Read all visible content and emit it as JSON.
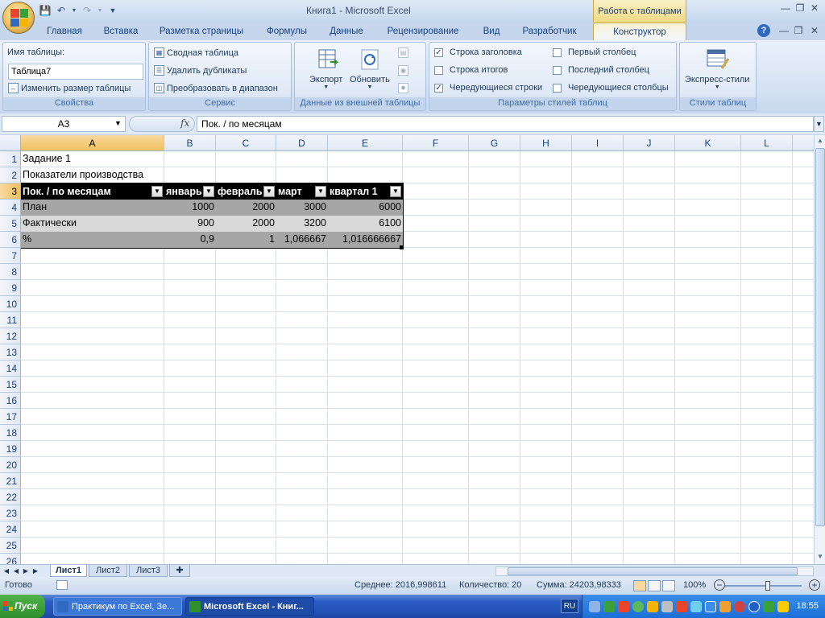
{
  "app": {
    "title": "Книга1 - Microsoft Excel",
    "context_tab_header": "Работа с таблицами"
  },
  "ribbon_tabs": [
    "Главная",
    "Вставка",
    "Разметка страницы",
    "Формулы",
    "Данные",
    "Рецензирование",
    "Вид",
    "Разработчик",
    "Конструктор"
  ],
  "ribbon": {
    "properties": {
      "title": "Свойства",
      "name_label": "Имя таблицы:",
      "name_value": "Таблица7",
      "resize_label": "Изменить размер таблицы"
    },
    "tools": {
      "title": "Сервис",
      "pivot_label": "Сводная таблица",
      "remove_dup_label": "Удалить дубликаты",
      "convert_label": "Преобразовать в диапазон"
    },
    "external": {
      "title": "Данные из внешней таблицы",
      "export_label": "Экспорт",
      "refresh_label": "Обновить"
    },
    "style_options": {
      "title": "Параметры стилей таблиц",
      "header_row": {
        "label": "Строка заголовка",
        "checked": true
      },
      "total_row": {
        "label": "Строка итогов",
        "checked": false
      },
      "banded_rows": {
        "label": "Чередующиеся строки",
        "checked": true
      },
      "first_column": {
        "label": "Первый столбец",
        "checked": false
      },
      "last_column": {
        "label": "Последний столбец",
        "checked": false
      },
      "banded_columns": {
        "label": "Чередующиеся столбцы",
        "checked": false
      }
    },
    "table_styles": {
      "title": "Стили таблиц",
      "quick_styles_label": "Экспресс-стили"
    }
  },
  "formula_bar": {
    "name_box": "A3",
    "fx": "fx",
    "formula": "Пок. / по месяцам"
  },
  "grid": {
    "columns": [
      "A",
      "B",
      "C",
      "D",
      "E",
      "F",
      "G",
      "H",
      "I",
      "J",
      "K",
      "L"
    ],
    "rows": [
      "1",
      "2",
      "3",
      "4",
      "5",
      "6",
      "7",
      "8",
      "9",
      "10",
      "11",
      "12",
      "13",
      "14",
      "15",
      "16",
      "17",
      "18",
      "19",
      "20",
      "21",
      "22",
      "23",
      "24",
      "25",
      "26"
    ],
    "a1": "Задание 1",
    "a2": "Показатели производства",
    "table_headers": [
      "Пок. / по месяцам",
      "январь",
      "февраль",
      "март",
      "квартал 1"
    ],
    "table_rows": [
      [
        "План",
        "1000",
        "2000",
        "3000",
        "6000"
      ],
      [
        "Фактически",
        "900",
        "2000",
        "3200",
        "6100"
      ],
      [
        "%",
        "0,9",
        "1",
        "1,066667",
        "1,016666667"
      ]
    ]
  },
  "sheets": [
    "Лист1",
    "Лист2",
    "Лист3"
  ],
  "status": {
    "ready": "Готово",
    "average": "Среднее: 2016,998611",
    "count": "Количество: 20",
    "sum": "Сумма: 24203,98333",
    "zoom": "100%"
  },
  "taskbar": {
    "start": "Пуск",
    "windows": [
      "Практикум по Excel, Зе...",
      "Microsoft Excel - Книг..."
    ],
    "lang": "RU",
    "clock": "18:55"
  },
  "colors": {
    "table_header_bg": "#000000",
    "band_dark": "#a6a6a6",
    "band_light": "#d9d9d9",
    "selection": "#f1c15f"
  }
}
